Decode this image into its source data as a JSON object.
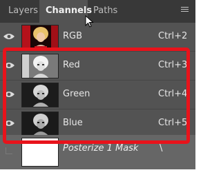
{
  "tabs": [
    {
      "label": "Layers"
    },
    {
      "label": "Channels",
      "active": true
    },
    {
      "label": "Paths"
    }
  ],
  "channels": [
    {
      "name": "RGB",
      "shortcut": "Ctrl+2",
      "thumb": "color-portrait"
    },
    {
      "name": "Red",
      "shortcut": "Ctrl+3",
      "thumb": "grayscale-posterized-portrait"
    },
    {
      "name": "Green",
      "shortcut": "Ctrl+4",
      "thumb": "grayscale-posterized-portrait"
    },
    {
      "name": "Blue",
      "shortcut": "Ctrl+5",
      "thumb": "grayscale-posterized-portrait"
    }
  ],
  "mask": {
    "name": "Posterize 1 Mask",
    "shortcut": "\\"
  },
  "icons": {
    "visibility": "eye-icon",
    "menu": "panel-menu-icon"
  },
  "colors": {
    "highlight": "#e8131b",
    "panel_bg": "#535353",
    "tab_bar": "#383838"
  }
}
